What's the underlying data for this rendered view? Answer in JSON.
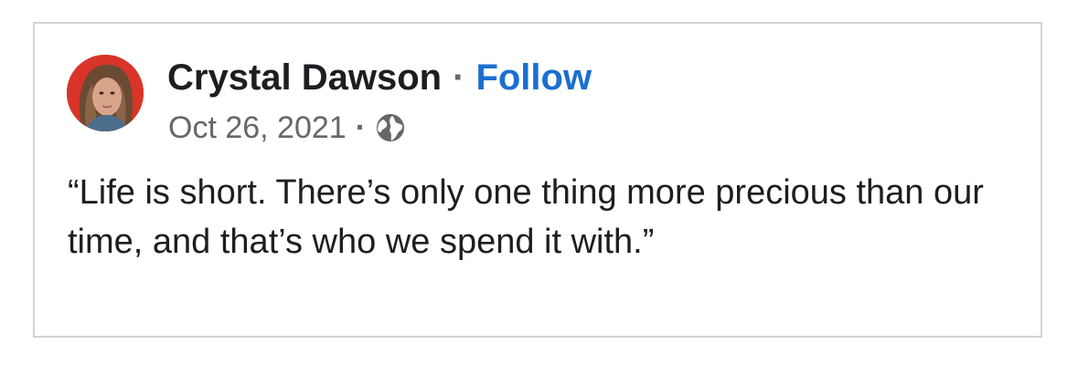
{
  "post": {
    "author": {
      "name": "Crystal Dawson",
      "avatar_icon": "profile-photo"
    },
    "separator": "·",
    "follow_label": "Follow",
    "date": "Oct 26, 2021",
    "audience_icon": "globe-icon",
    "text": "“Life is short. There’s only one thing more precious than our time, and that’s who we spend it with.”"
  },
  "colors": {
    "name": "#1c1e21",
    "follow": "#1b6fd0",
    "meta": "#65676b",
    "border": "#d3d3d3",
    "avatar_background": "#d42a1f"
  }
}
